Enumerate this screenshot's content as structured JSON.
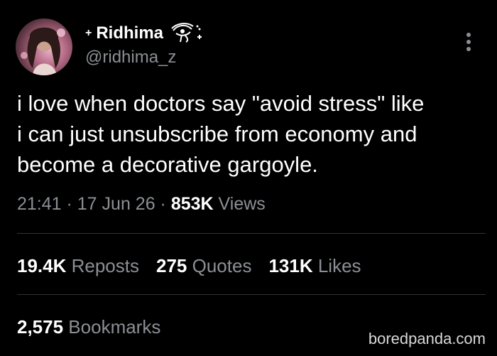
{
  "author": {
    "prefix_symbol": "+",
    "display_name": "Ridhima",
    "name_icon": "eye-of-horus-icon",
    "handle": "@ridhima_z",
    "avatar": "profile-photo"
  },
  "tweet": {
    "text": "i love when doctors say \"avoid stress\" like\ni can just unsubscribe from economy and\nbecome a decorative gargoyle."
  },
  "meta": {
    "time": "21:41",
    "separator_1": " · ",
    "date": "17 Jun 26",
    "separator_2": " · ",
    "views_count": "853K",
    "views_label": " Views"
  },
  "stats": {
    "reposts_count": "19.4K",
    "reposts_label": " Reposts",
    "quotes_count": "275",
    "quotes_label": " Quotes",
    "likes_count": "131K",
    "likes_label": " Likes"
  },
  "bookmarks": {
    "count": "2,575",
    "label": " Bookmarks"
  },
  "watermark": "boredpanda.com",
  "colors": {
    "background": "#000000",
    "text_primary": "#ffffff",
    "text_secondary": "#8b8f94",
    "divider": "#2f3336"
  }
}
